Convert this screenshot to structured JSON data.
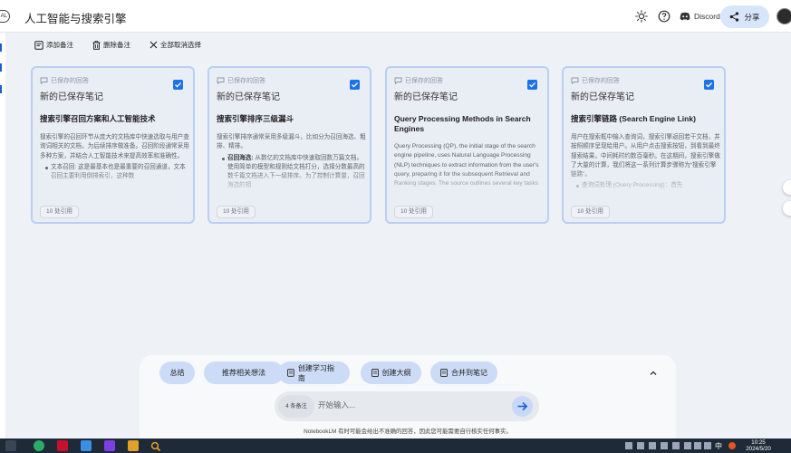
{
  "window": {
    "left_tab_text": "AL",
    "title": "人工智能与搜索引擎",
    "discord_label": "Discord",
    "share_label": "分享"
  },
  "toolbar": {
    "add_note": "添加备注",
    "delete_note": "删除备注",
    "deselect_all": "全部取消选择"
  },
  "cards": [
    {
      "label": "已保存的回答",
      "subtitle": "新的已保存笔记",
      "title": "搜索引擎召回方案和人工智能技术",
      "body": "搜索引擎的召回环节从庞大的文档库中快速选取与用户查询词相关的文档，为后续排序做准备。召回阶段通常采用多种方案，并结合人工智能技术来提高效率和准确性。",
      "bullet_strong": "",
      "bullet": "文本召回: 这是最基本也是最重要的召回通道，文本召回主要利用倒排索引，这种数",
      "tag": "10 处引用"
    },
    {
      "label": "已保存的回答",
      "subtitle": "新的已保存笔记",
      "title": "搜索引擎排序三级漏斗",
      "body": "搜索引擎排序通常采用多级漏斗，比如分为召回海选、粗排、精排。",
      "bullet_strong": "召回海选:",
      "bullet": " 从数亿的文档库中快速取回数万篇文档。使用简单的模型和规则给文档打分，选择分数最高的数千篇文档进入下一级排序。为了控制计算量，召回海选的相",
      "tag": "10 处引用"
    },
    {
      "label": "已保存的回答",
      "subtitle": "新的已保存笔记",
      "title": "Query Processing Methods in Search Engines",
      "body": "Query Processing (QP), the initial stage of the search engine pipeline, uses Natural Language Processing (NLP) techniques to extract information from the user's query, preparing it for the subsequent Retrieval and Ranking stages. The source outlines several key tasks",
      "bullet_strong": "",
      "bullet": "",
      "tag": "10 处引用"
    },
    {
      "label": "已保存的回答",
      "subtitle": "新的已保存笔记",
      "title": "搜索引擎链路 (Search Engine Link)",
      "body": "用户在搜索框中输入查询词，搜索引擎返回若干文档，并按照顺序呈现给用户。从用户点击搜索按钮，到看到最终搜索结果，中间耗时约数百毫秒。在这期间，搜索引擎做了大量的计算，我们将这一系列计算步骤称为“搜索引擎链路”。",
      "bullet_strong": "",
      "bullet": "查询词处理 (Query Processing)：首先",
      "tag": "10 处引用"
    }
  ],
  "chat": {
    "chips": [
      "总结",
      "推荐相关想法",
      "创建学习指南",
      "创建大纲",
      "合并到笔记"
    ],
    "source_count": "4 条备注",
    "input_placeholder": "开始输入...",
    "disclaimer": "NotebookLM 有时可能会给出不准确的回答，因此您可能需要自行核实任何事实。"
  },
  "taskbar": {
    "tray_text": "中",
    "time": "10:25",
    "date": "2024/5/20"
  },
  "colors": {
    "accent": "#1a73e8",
    "card_border": "#b9cff4",
    "chip_bg": "#ccdcf6",
    "background": "#eef1f6"
  },
  "icons": {
    "theme": "sun-icon",
    "help": "help-icon",
    "discord": "discord-icon",
    "share": "share-icon",
    "add": "note-add-icon",
    "delete": "trash-icon",
    "deselect": "close-icon",
    "send": "arrow-right-icon"
  }
}
